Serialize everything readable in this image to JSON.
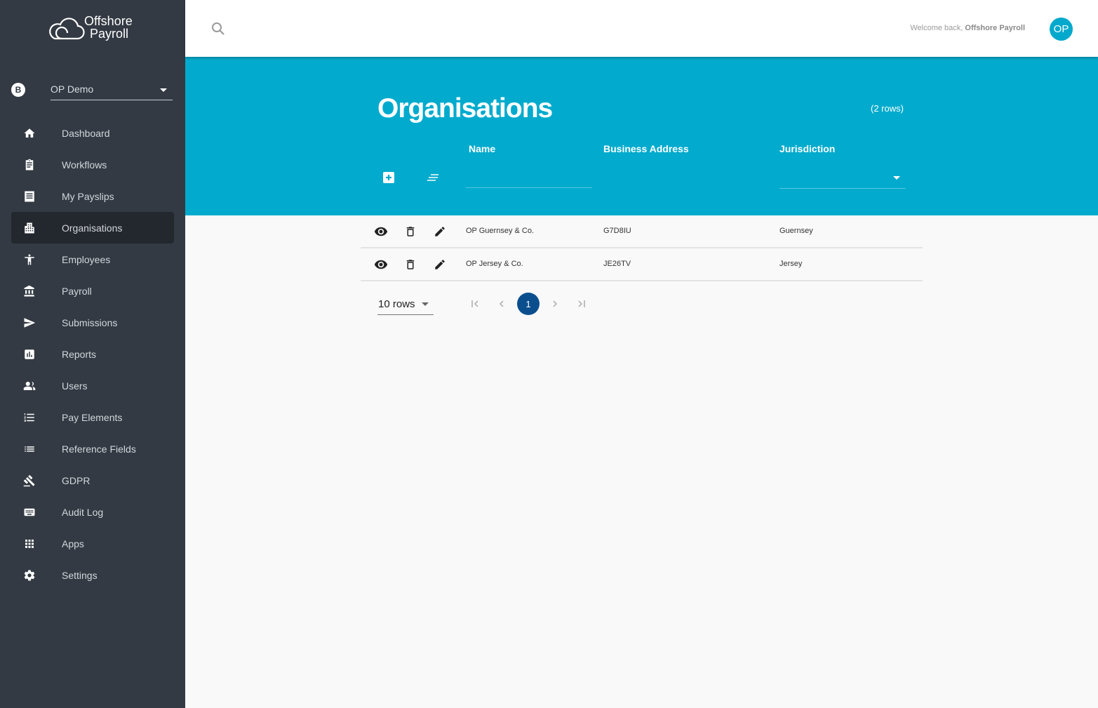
{
  "app": {
    "brand_line1": "Offshore",
    "brand_line2": "Payroll"
  },
  "org_switcher": {
    "badge": "B",
    "selected": "OP Demo"
  },
  "sidebar": {
    "items": [
      {
        "label": "Dashboard",
        "icon": "home-icon"
      },
      {
        "label": "Workflows",
        "icon": "clipboard-icon"
      },
      {
        "label": "My Payslips",
        "icon": "receipt-icon"
      },
      {
        "label": "Organisations",
        "icon": "building-icon",
        "active": true
      },
      {
        "label": "Employees",
        "icon": "person-icon"
      },
      {
        "label": "Payroll",
        "icon": "bank-icon"
      },
      {
        "label": "Submissions",
        "icon": "send-icon"
      },
      {
        "label": "Reports",
        "icon": "chart-icon"
      },
      {
        "label": "Users",
        "icon": "people-icon"
      },
      {
        "label": "Pay Elements",
        "icon": "numbered-list-icon"
      },
      {
        "label": "Reference Fields",
        "icon": "list-icon"
      },
      {
        "label": "GDPR",
        "icon": "gavel-icon"
      },
      {
        "label": "Audit Log",
        "icon": "keyboard-icon"
      },
      {
        "label": "Apps",
        "icon": "apps-grid-icon"
      },
      {
        "label": "Settings",
        "icon": "gear-icon"
      }
    ]
  },
  "header": {
    "welcome_prefix": "Welcome back, ",
    "welcome_name": "Offshore Payroll",
    "avatar_initials": "OP"
  },
  "page": {
    "title": "Organisations",
    "row_count": "(2 rows)"
  },
  "table": {
    "columns": [
      "Name",
      "Business Address",
      "Jurisdiction"
    ],
    "filters": {
      "name_value": "",
      "jurisdiction_value": ""
    },
    "rows": [
      {
        "name": "OP Guernsey & Co.",
        "business_address": "G7D8IU",
        "jurisdiction": "Guernsey"
      },
      {
        "name": "OP Jersey & Co.",
        "business_address": "JE26TV",
        "jurisdiction": "Jersey"
      }
    ]
  },
  "pagination": {
    "rows_per_page": "10 rows",
    "current_page": "1"
  },
  "colors": {
    "sidebar_bg": "#333a43",
    "accent": "#02abcd",
    "current_page": "#0b4e8e"
  }
}
